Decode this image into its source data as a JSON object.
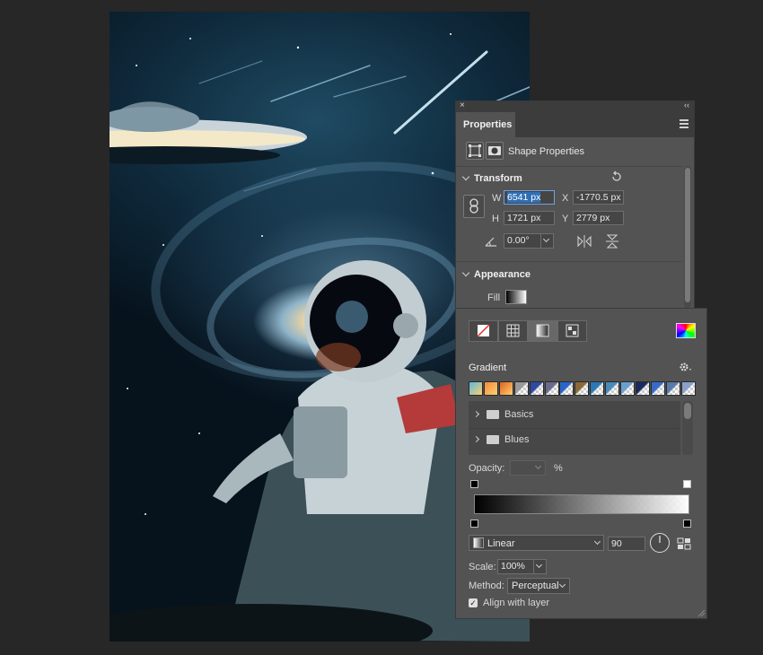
{
  "panel": {
    "close": "×",
    "collapse": "‹‹",
    "tab": "Properties",
    "subtitle": "Shape Properties",
    "transform": {
      "title": "Transform",
      "w_label": "W",
      "w_value": "6541 px",
      "x_label": "X",
      "x_value": "-1770.5 px",
      "h_label": "H",
      "h_value": "1721 px",
      "y_label": "Y",
      "y_value": "2779 px",
      "angle_value": "0.00°"
    },
    "appearance": {
      "title": "Appearance",
      "fill_label": "Fill"
    }
  },
  "gradient_popover": {
    "title": "Gradient",
    "swatches": [
      "#5ab8e0",
      "#f08a3c",
      "#e0601e",
      "#9a9a9a",
      "#2e4aa0",
      "#6a6a8a",
      "#2a64c8",
      "#8a6a3a",
      "#2a78b8",
      "#4a8ab8",
      "#6aa0d0",
      "#1a2a60",
      "#3a6ac8",
      "#5a7aa8",
      "#8aa0c8"
    ],
    "folders": [
      "Basics",
      "Blues"
    ],
    "opacity_label": "Opacity:",
    "opacity_unit": "%",
    "type_value": "Linear",
    "angle_value": "90",
    "scale_label": "Scale:",
    "scale_value": "100%",
    "method_label": "Method:",
    "method_value": "Perceptual",
    "align_label": "Align with layer",
    "align_checked": true
  }
}
